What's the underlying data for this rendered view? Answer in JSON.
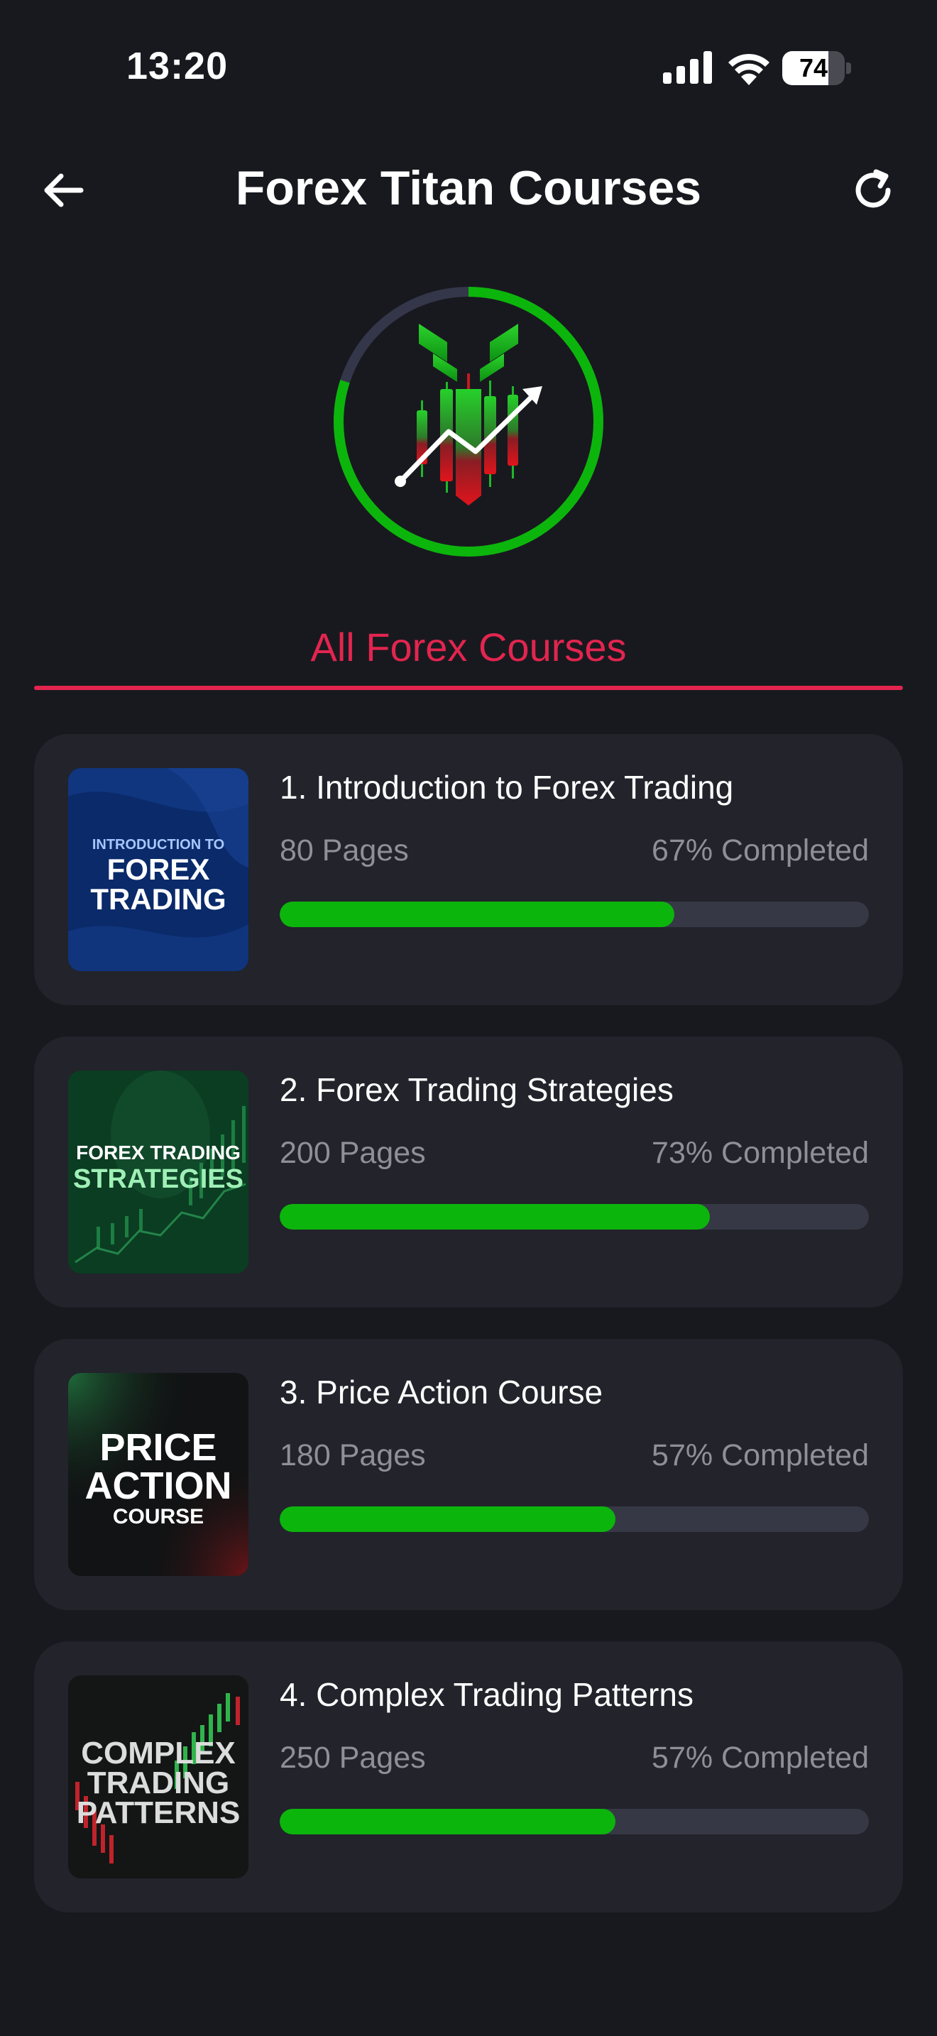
{
  "status_bar": {
    "time": "13:20",
    "battery": "74",
    "battery_level": 0.74
  },
  "header": {
    "title": "Forex Titan Courses",
    "back_icon": "arrow-left-icon",
    "refresh_icon": "refresh-icon"
  },
  "logo": {
    "progress_fraction": 0.8,
    "accent": "#0cb50c",
    "track": "#34364a"
  },
  "tabs": [
    {
      "label": "All Forex Courses",
      "active": true
    }
  ],
  "colors": {
    "accent": "#e2254f",
    "progress": "#0cb50c",
    "card": "#22232b",
    "background": "#18191e"
  },
  "courses": [
    {
      "title": "1. Introduction to Forex Trading",
      "pages": "80 Pages",
      "completed": "67% Completed",
      "progress": 0.67,
      "thumb": {
        "line1": "INTRODUCTION TO",
        "line2": "FOREX",
        "line3": "TRADING"
      }
    },
    {
      "title": "2. Forex Trading Strategies",
      "pages": "200 Pages",
      "completed": "73% Completed",
      "progress": 0.73,
      "thumb": {
        "line1": "FOREX TRADING",
        "line2": "STRATEGIES"
      }
    },
    {
      "title": "3. Price Action Course",
      "pages": "180 Pages",
      "completed": "57% Completed",
      "progress": 0.57,
      "thumb": {
        "line1": "PRICE",
        "line2": "ACTION",
        "line3": "COURSE"
      }
    },
    {
      "title": "4. Complex Trading Patterns",
      "pages": "250 Pages",
      "completed": "57% Completed",
      "progress": 0.57,
      "thumb": {
        "line1": "COMPLEX",
        "line2": "TRADING",
        "line3": "PATTERNS"
      }
    }
  ]
}
